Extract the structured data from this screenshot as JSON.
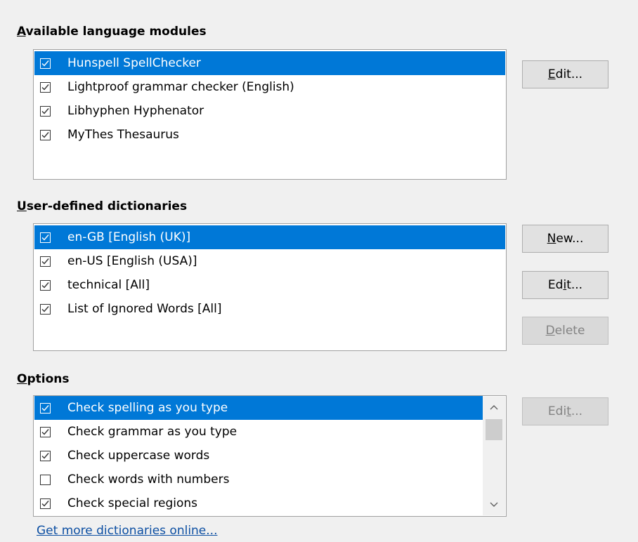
{
  "sections": {
    "modules": {
      "label_pre": "",
      "label_u": "A",
      "label_post": "vailable language modules",
      "items": [
        {
          "label": "Hunspell SpellChecker",
          "checked": true,
          "selected": true
        },
        {
          "label": "Lightproof grammar checker (English)",
          "checked": true,
          "selected": false
        },
        {
          "label": "Libhyphen Hyphenator",
          "checked": true,
          "selected": false
        },
        {
          "label": "MyThes Thesaurus",
          "checked": true,
          "selected": false
        }
      ],
      "edit_pre": "",
      "edit_u": "E",
      "edit_post": "dit..."
    },
    "dictionaries": {
      "label_pre": "",
      "label_u": "U",
      "label_post": "ser-defined dictionaries",
      "items": [
        {
          "label": "en-GB [English (UK)]",
          "checked": true,
          "selected": true
        },
        {
          "label": "en-US [English (USA)]",
          "checked": true,
          "selected": false
        },
        {
          "label": "technical [All]",
          "checked": true,
          "selected": false
        },
        {
          "label": "List of Ignored Words [All]",
          "checked": true,
          "selected": false
        }
      ],
      "new_pre": "",
      "new_u": "N",
      "new_post": "ew...",
      "edit_pre": "Ed",
      "edit_u": "i",
      "edit_post": "t...",
      "delete_pre": "",
      "delete_u": "D",
      "delete_post": "elete"
    },
    "options": {
      "label_pre": "",
      "label_u": "O",
      "label_post": "ptions",
      "items": [
        {
          "label": "Check spelling as you type",
          "checked": true,
          "selected": true
        },
        {
          "label": "Check grammar as you type",
          "checked": true,
          "selected": false
        },
        {
          "label": "Check uppercase words",
          "checked": true,
          "selected": false
        },
        {
          "label": "Check words with numbers",
          "checked": false,
          "selected": false
        },
        {
          "label": "Check special regions",
          "checked": true,
          "selected": false
        }
      ],
      "edit_pre": "Edi",
      "edit_u": "t",
      "edit_post": "..."
    }
  },
  "link": "Get more dictionaries online..."
}
